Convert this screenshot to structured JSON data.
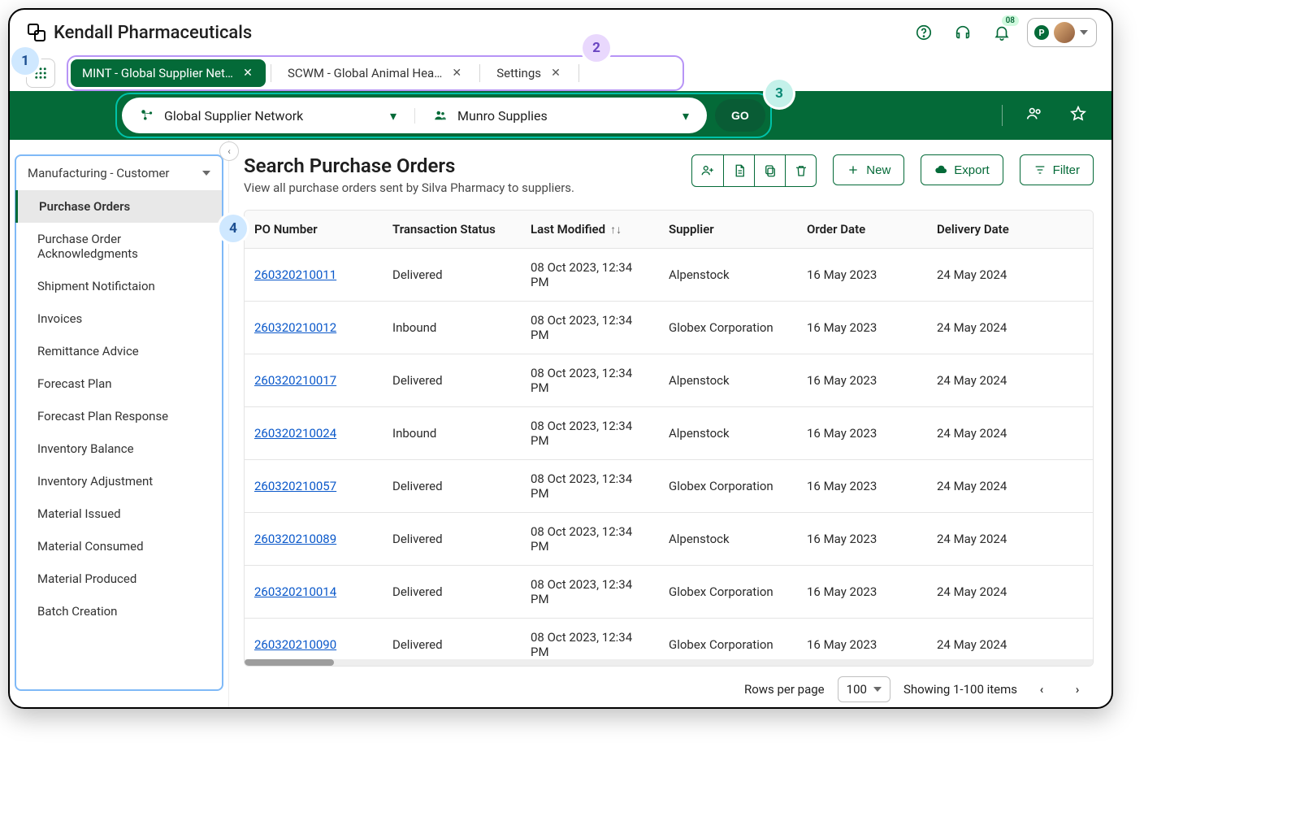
{
  "annotations": {
    "a1": "1",
    "a2": "2",
    "a3": "3",
    "a4": "4"
  },
  "header": {
    "company": "Kendall Pharmaceuticals",
    "bell_badge": "08",
    "presence_initial": "P"
  },
  "tabs": [
    {
      "label": "MINT - Global Supplier Net…",
      "active": true
    },
    {
      "label": "SCWM - Global Animal Hea…",
      "active": false
    },
    {
      "label": "Settings",
      "active": false
    }
  ],
  "context": {
    "network_label": "Global Supplier Network",
    "partner_label": "Munro Supplies",
    "go_label": "GO"
  },
  "sidebar": {
    "head": "Manufacturing - Customer",
    "items": [
      "Purchase Orders",
      "Purchase Order Acknowledgments",
      "Shipment Notifictaion",
      "Invoices",
      "Remittance Advice",
      "Forecast Plan",
      "Forecast Plan Response",
      "Inventory Balance",
      "Inventory Adjustment",
      "Material Issued",
      "Material Consumed",
      "Material Produced",
      "Batch Creation"
    ],
    "active_index": 0
  },
  "main": {
    "title": "Search Purchase Orders",
    "subtitle": "View all purchase orders sent by Silva Pharmacy to suppliers.",
    "buttons": {
      "new": "New",
      "export": "Export",
      "filter": "Filter"
    },
    "columns": [
      "PO Number",
      "Transaction Status",
      "Last Modified",
      "Supplier",
      "Order Date",
      "Delivery Date"
    ],
    "sort_col_index": 2,
    "rows": [
      {
        "po": "260320210011",
        "status": "Delivered",
        "modified": "08 Oct 2023, 12:34 PM",
        "supplier": "Alpenstock",
        "order": "16 May 2023",
        "delivery": "24 May 2024"
      },
      {
        "po": "260320210012",
        "status": "Inbound",
        "modified": "08 Oct 2023, 12:34 PM",
        "supplier": "Globex Corporation",
        "order": "16 May 2023",
        "delivery": "24 May 2024"
      },
      {
        "po": "260320210017",
        "status": "Delivered",
        "modified": "08 Oct 2023, 12:34 PM",
        "supplier": "Alpenstock",
        "order": "16 May 2023",
        "delivery": "24 May 2024"
      },
      {
        "po": "260320210024",
        "status": "Inbound",
        "modified": "08 Oct 2023, 12:34 PM",
        "supplier": "Alpenstock",
        "order": "16 May 2023",
        "delivery": "24 May 2024"
      },
      {
        "po": "260320210057",
        "status": "Delivered",
        "modified": "08 Oct 2023, 12:34 PM",
        "supplier": "Globex Corporation",
        "order": "16 May 2023",
        "delivery": "24 May 2024"
      },
      {
        "po": "260320210089",
        "status": "Delivered",
        "modified": "08 Oct 2023, 12:34 PM",
        "supplier": "Alpenstock",
        "order": "16 May 2023",
        "delivery": "24 May 2024"
      },
      {
        "po": "260320210014",
        "status": "Delivered",
        "modified": "08 Oct 2023, 12:34 PM",
        "supplier": "Globex Corporation",
        "order": "16 May 2023",
        "delivery": "24 May 2024"
      },
      {
        "po": "260320210090",
        "status": "Delivered",
        "modified": "08 Oct 2023, 12:34 PM",
        "supplier": "Globex Corporation",
        "order": "16 May 2023",
        "delivery": "24 May 2024"
      }
    ],
    "pager": {
      "rows_label": "Rows per page",
      "rows_value": "100",
      "showing": "Showing 1-100 items"
    }
  }
}
